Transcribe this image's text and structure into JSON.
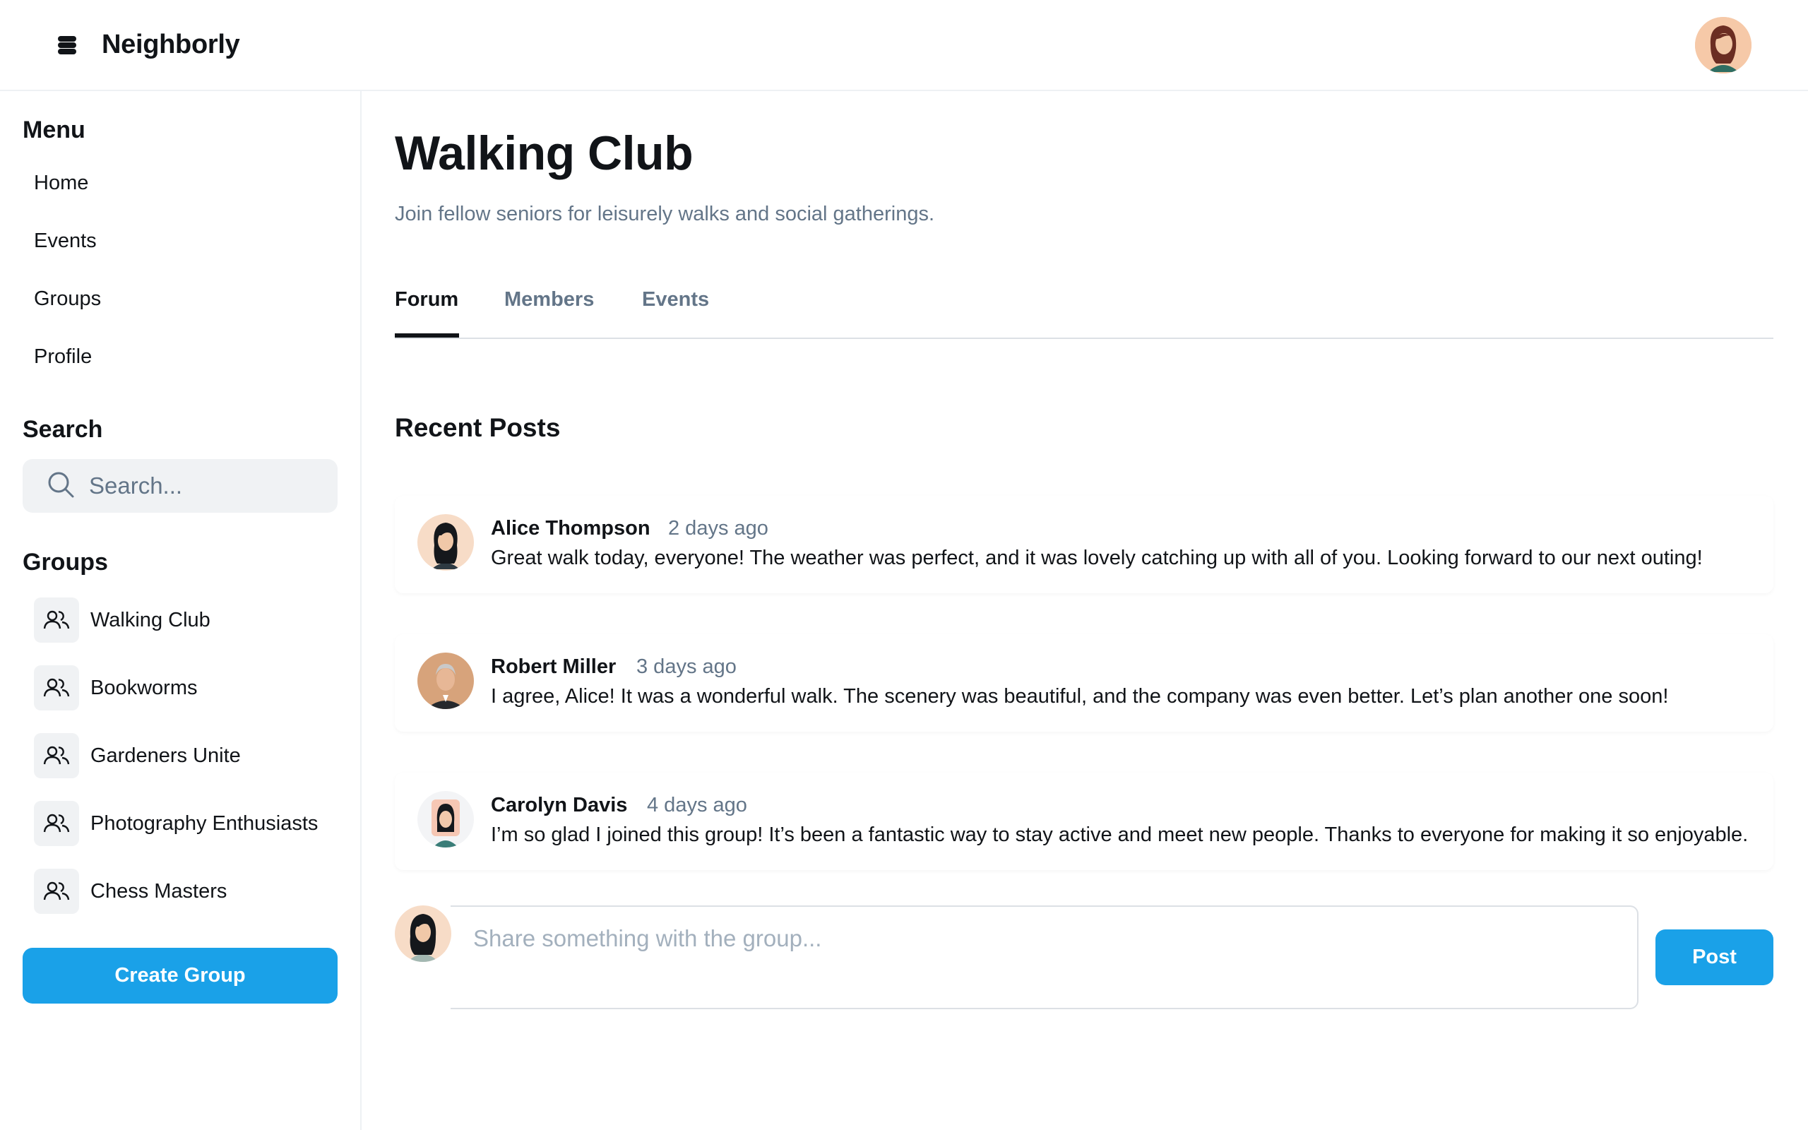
{
  "app": {
    "brand": "Neighborly",
    "logo_icon": "stack-icon"
  },
  "sidebar": {
    "menu_heading": "Menu",
    "menu": [
      "Home",
      "Events",
      "Groups",
      "Profile"
    ],
    "search_heading": "Search",
    "search_placeholder": "Search...",
    "groups_heading": "Groups",
    "groups": [
      "Walking Club",
      "Bookworms",
      "Gardeners Unite",
      "Photography Enthusiasts",
      "Chess Masters"
    ],
    "create_button": "Create Group"
  },
  "main": {
    "title": "Walking Club",
    "subtitle": "Join fellow seniors for leisurely walks and social gatherings.",
    "tabs": [
      "Forum",
      "Members",
      "Events"
    ],
    "active_tab": "Forum",
    "section_title": "Recent Posts",
    "posts": [
      {
        "author": "Alice Thompson",
        "time": "2 days ago",
        "text": "Great walk today, everyone! The weather was perfect, and it was lovely catching up with all of you. Looking forward to our next outing!"
      },
      {
        "author": "Robert Miller",
        "time": "3 days ago",
        "text": "I agree, Alice! It was a wonderful walk. The scenery was beautiful, and the company was even better. Let’s plan another one soon!"
      },
      {
        "author": "Carolyn Davis",
        "time": "4 days ago",
        "text": "I’m so glad I joined this group! It’s been a fantastic way to stay active and meet new people. Thanks to everyone for making it so enjoyable."
      }
    ],
    "composer_placeholder": "Share something with the group...",
    "post_button": "Post"
  },
  "colors": {
    "accent": "#1aa1e8",
    "muted_text": "#637588",
    "surface": "#f0f2f4"
  }
}
